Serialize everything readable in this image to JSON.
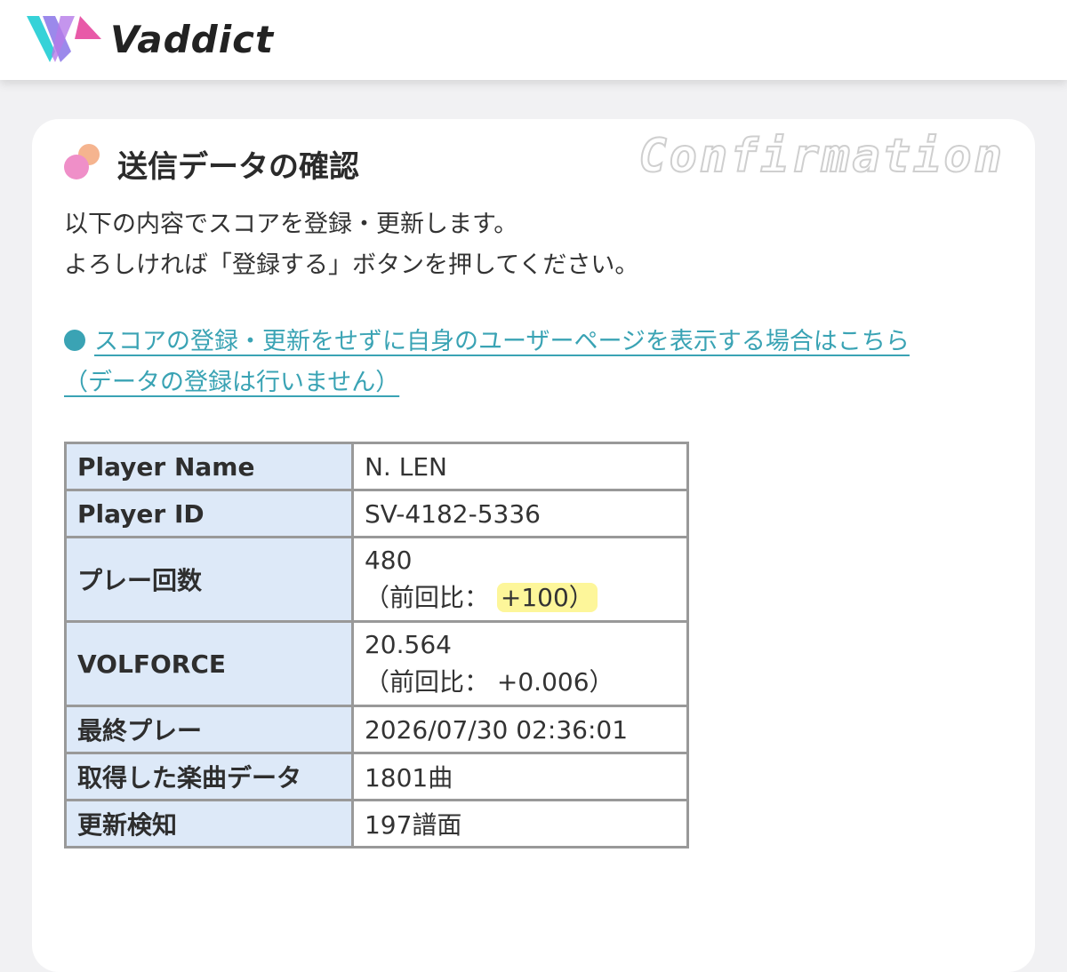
{
  "header": {
    "brand": "Vaddict",
    "logo_icon": "vaddict-logo-icon"
  },
  "card": {
    "title": "送信データの確認",
    "title_en": "Confirmation",
    "description_lines": [
      "以下の内容でスコアを登録・更新します。",
      "よろしければ「登録する」ボタンを押してください。"
    ],
    "link_line1": "スコアの登録・更新をせずに自身のユーザーページを表示する場合はこちら",
    "link_line2": "（データの登録は行いません）"
  },
  "table": {
    "rows": [
      {
        "label": "Player Name",
        "value": "N. LEN"
      },
      {
        "label": "Player ID",
        "value": "SV-4182-5336"
      },
      {
        "label": "プレー回数",
        "value": "480",
        "sub_prefix": "（前回比：",
        "sub_value": "+100）"
      },
      {
        "label": "VOLFORCE",
        "value": "20.564",
        "sub_prefix": "（前回比：",
        "sub_value": "+0.006）"
      },
      {
        "label": "最終プレー",
        "value": "2026/07/30 02:36:01"
      },
      {
        "label": "取得した楽曲データ",
        "value": "1801曲"
      },
      {
        "label": "更新検知",
        "value": "197譜面"
      }
    ]
  },
  "colors": {
    "accent_link": "#3aa3b4",
    "table_key_bg": "#dde9f8",
    "highlight": "#fdf69a",
    "logo_cyan": "#36d2d8",
    "logo_pink": "#e85aa8",
    "dot_pink": "#ef8fc8",
    "dot_orange": "#f5b48f"
  }
}
